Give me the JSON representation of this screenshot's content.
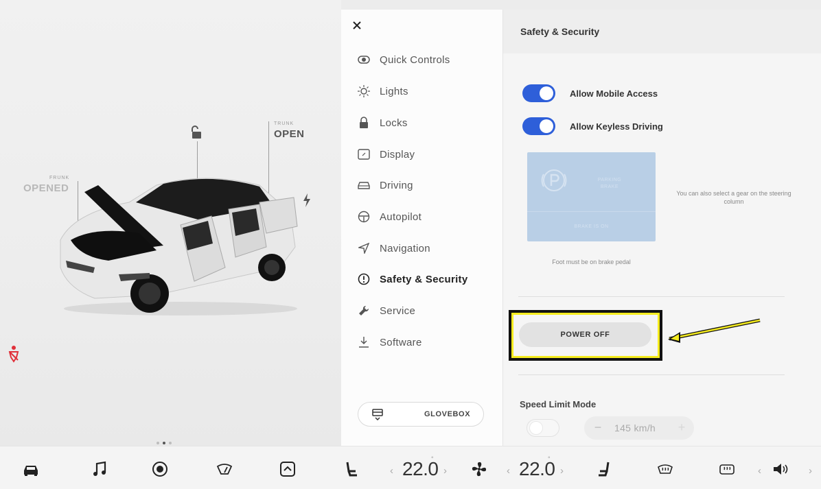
{
  "car_status": {
    "frunk_label": "FRUNK",
    "frunk_value": "OPENED",
    "trunk_label": "TRUNK",
    "trunk_value": "OPEN",
    "page_dots": 3,
    "active_page": 2
  },
  "menu": {
    "items": [
      {
        "label": "Quick Controls",
        "icon": "toggle-icon"
      },
      {
        "label": "Lights",
        "icon": "light-bulb-icon"
      },
      {
        "label": "Locks",
        "icon": "lock-icon"
      },
      {
        "label": "Display",
        "icon": "display-icon"
      },
      {
        "label": "Driving",
        "icon": "car-icon"
      },
      {
        "label": "Autopilot",
        "icon": "steering-wheel-icon"
      },
      {
        "label": "Navigation",
        "icon": "navigation-arrow-icon"
      },
      {
        "label": "Safety & Security",
        "icon": "alert-circle-icon",
        "active": true
      },
      {
        "label": "Service",
        "icon": "wrench-icon"
      },
      {
        "label": "Software",
        "icon": "download-icon"
      }
    ],
    "glovebox_label": "GLOVEBOX"
  },
  "settings": {
    "title": "Safety & Security",
    "allow_mobile_access": {
      "label": "Allow Mobile Access",
      "on": true
    },
    "allow_keyless_driving": {
      "label": "Allow Keyless Driving",
      "on": true
    },
    "park_box": {
      "line1": "PARKING",
      "line2": "BRAKE",
      "bottom": "BRAKE IS ON"
    },
    "brake_hint": "Foot must be on brake pedal",
    "gear_hint": "You can also select a gear on the steering column",
    "power_off_label": "POWER OFF",
    "speed_limit": {
      "label": "Speed Limit Mode",
      "on": false,
      "value": "145 km/h",
      "minus": "−",
      "plus": "+"
    }
  },
  "bottom_bar": {
    "temp_left": "22.0",
    "temp_right": "22.0",
    "chev_left": "‹",
    "chev_right": "›"
  },
  "colors": {
    "toggle_on": "#2e5fd9",
    "highlight": "#f5ec1f",
    "seatbelt_warning": "#e0303a"
  }
}
